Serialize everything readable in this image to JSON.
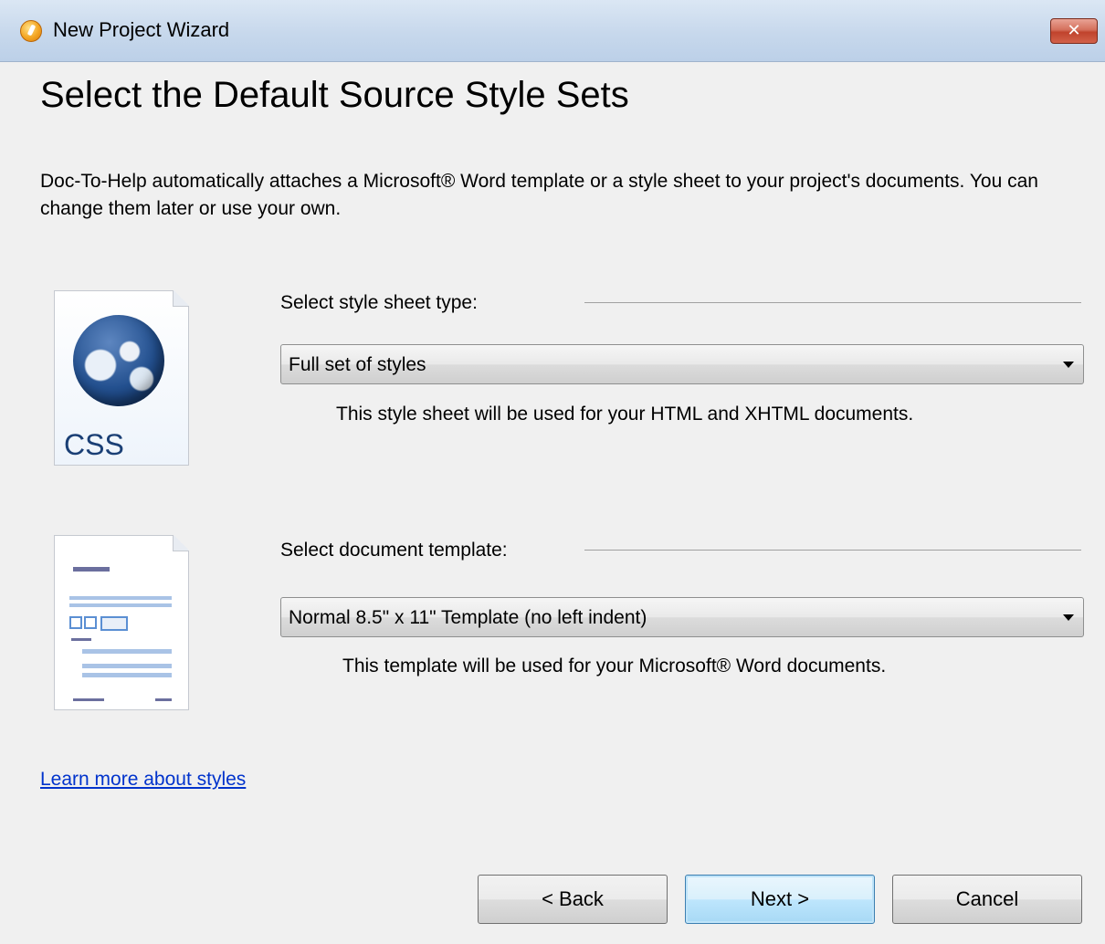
{
  "window": {
    "title": "New Project Wizard",
    "close_glyph": "✕"
  },
  "heading": "Select the Default Source Style Sets",
  "description": "Doc-To-Help automatically attaches a Microsoft® Word template or a style sheet to your project's documents. You can change them later or use your own.",
  "stylesheet": {
    "icon": "css-globe-icon",
    "icon_label": "CSS",
    "label": "Select style sheet type:",
    "selected": "Full set of styles",
    "hint": "This style sheet will be used for your HTML and XHTML documents."
  },
  "template": {
    "icon": "document-template-icon",
    "label": "Select document template:",
    "selected": "Normal 8.5\" x 11\" Template (no left indent)",
    "hint": "This template will be used for your Microsoft® Word documents."
  },
  "link": "Learn more about styles",
  "buttons": {
    "back": "< Back",
    "next": "Next >",
    "cancel": "Cancel"
  },
  "colors": {
    "link": "#0033cc",
    "default_button": "#3c7fb1"
  }
}
